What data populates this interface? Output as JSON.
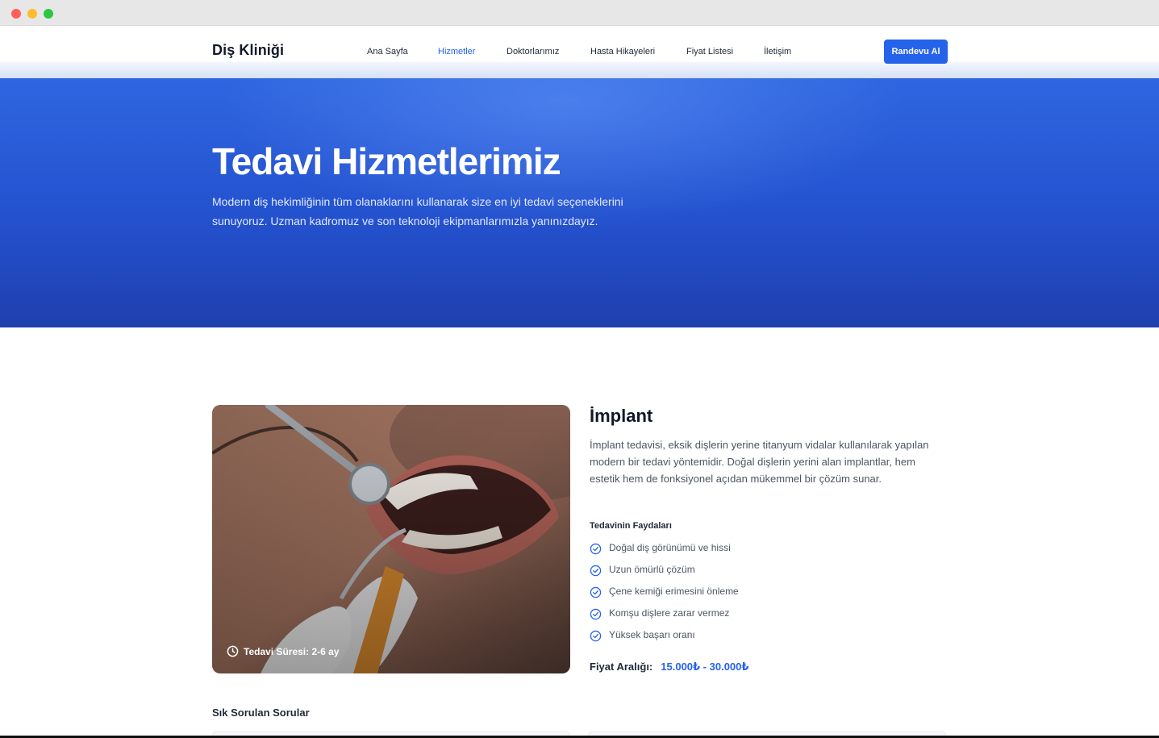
{
  "header": {
    "brand": "Diş Kliniği",
    "nav": [
      {
        "label": "Ana Sayfa",
        "active": false
      },
      {
        "label": "Hizmetler",
        "active": true
      },
      {
        "label": "Doktorlarımız",
        "active": false
      },
      {
        "label": "Hasta Hikayeleri",
        "active": false
      },
      {
        "label": "Fiyat Listesi",
        "active": false
      },
      {
        "label": "İletişim",
        "active": false
      }
    ],
    "cta_label": "Randevu Al"
  },
  "hero": {
    "title": "Tedavi Hizmetlerimiz",
    "description": "Modern diş hekimliğinin tüm olanaklarını kullanarak size en iyi tedavi seçeneklerini sunuyoruz. Uzman kadromuz ve son teknoloji ekipmanlarımızla yanınızdayız."
  },
  "service": {
    "title": "İmplant",
    "description": "İmplant tedavisi, eksik dişlerin yerine titanyum vidalar kullanılarak yapılan modern bir tedavi yöntemidir. Doğal dişlerin yerini alan implantlar, hem estetik hem de fonksiyonel açıdan mükemmel bir çözüm sunar.",
    "duration_label": "Tedavi Süresi: 2-6 ay",
    "benefits_title": "Tedavinin Faydaları",
    "benefits": [
      "Doğal diş görünümü ve hissi",
      "Uzun ömürlü çözüm",
      "Çene kemiği erimesini önleme",
      "Komşu dişlere zarar vermez",
      "Yüksek başarı oranı"
    ],
    "price_label": "Fiyat Aralığı:",
    "price_value": "15.000₺ - 30.000₺"
  },
  "faq": {
    "title": "Sık Sorulan Sorular"
  },
  "colors": {
    "accent": "#2563eb",
    "hero_top": "#2f66e0",
    "hero_bottom": "#1f3fae"
  },
  "icons": {
    "duration": "clock-icon",
    "benefit": "check-circle-icon"
  }
}
